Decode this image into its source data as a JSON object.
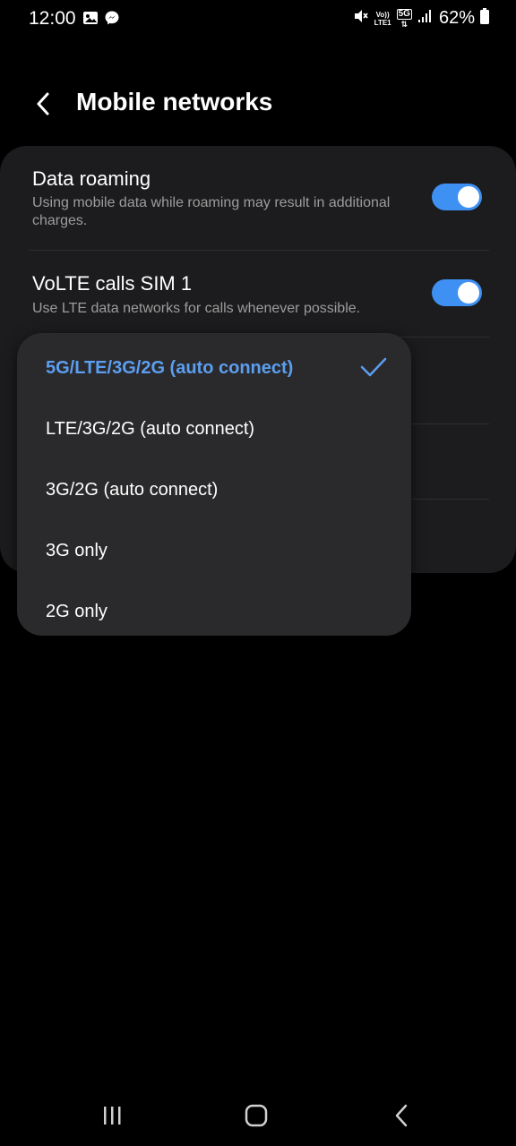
{
  "status_bar": {
    "time": "12:00",
    "battery": "62%",
    "volte_line1": "Vo))",
    "volte_line2": "LTE1",
    "network": "5G",
    "icons": [
      "gallery-icon",
      "messenger-icon",
      "mute-icon",
      "signal-icon",
      "battery-icon"
    ]
  },
  "header": {
    "title": "Mobile networks"
  },
  "settings": [
    {
      "title": "Data roaming",
      "subtitle": "Using mobile data while roaming may result in additional charges.",
      "enabled": true
    },
    {
      "title": "VoLTE calls SIM 1",
      "subtitle": "Use LTE data networks for calls whenever possible.",
      "enabled": true
    }
  ],
  "network_mode_menu": {
    "options": [
      {
        "label": "5G/LTE/3G/2G (auto connect)",
        "selected": true
      },
      {
        "label": "LTE/3G/2G (auto connect)",
        "selected": false
      },
      {
        "label": "3G/2G (auto connect)",
        "selected": false
      },
      {
        "label": "3G only",
        "selected": false
      },
      {
        "label": "2G only",
        "selected": false
      }
    ]
  },
  "colors": {
    "accent": "#3e91f2",
    "selected_text": "#5c9ef0",
    "card_bg": "#1c1c1e",
    "menu_bg": "#2a2a2c",
    "subtitle_text": "#9c9c9c"
  },
  "nav_bar": {
    "buttons": [
      "recent-apps-icon",
      "home-icon",
      "back-icon"
    ]
  }
}
